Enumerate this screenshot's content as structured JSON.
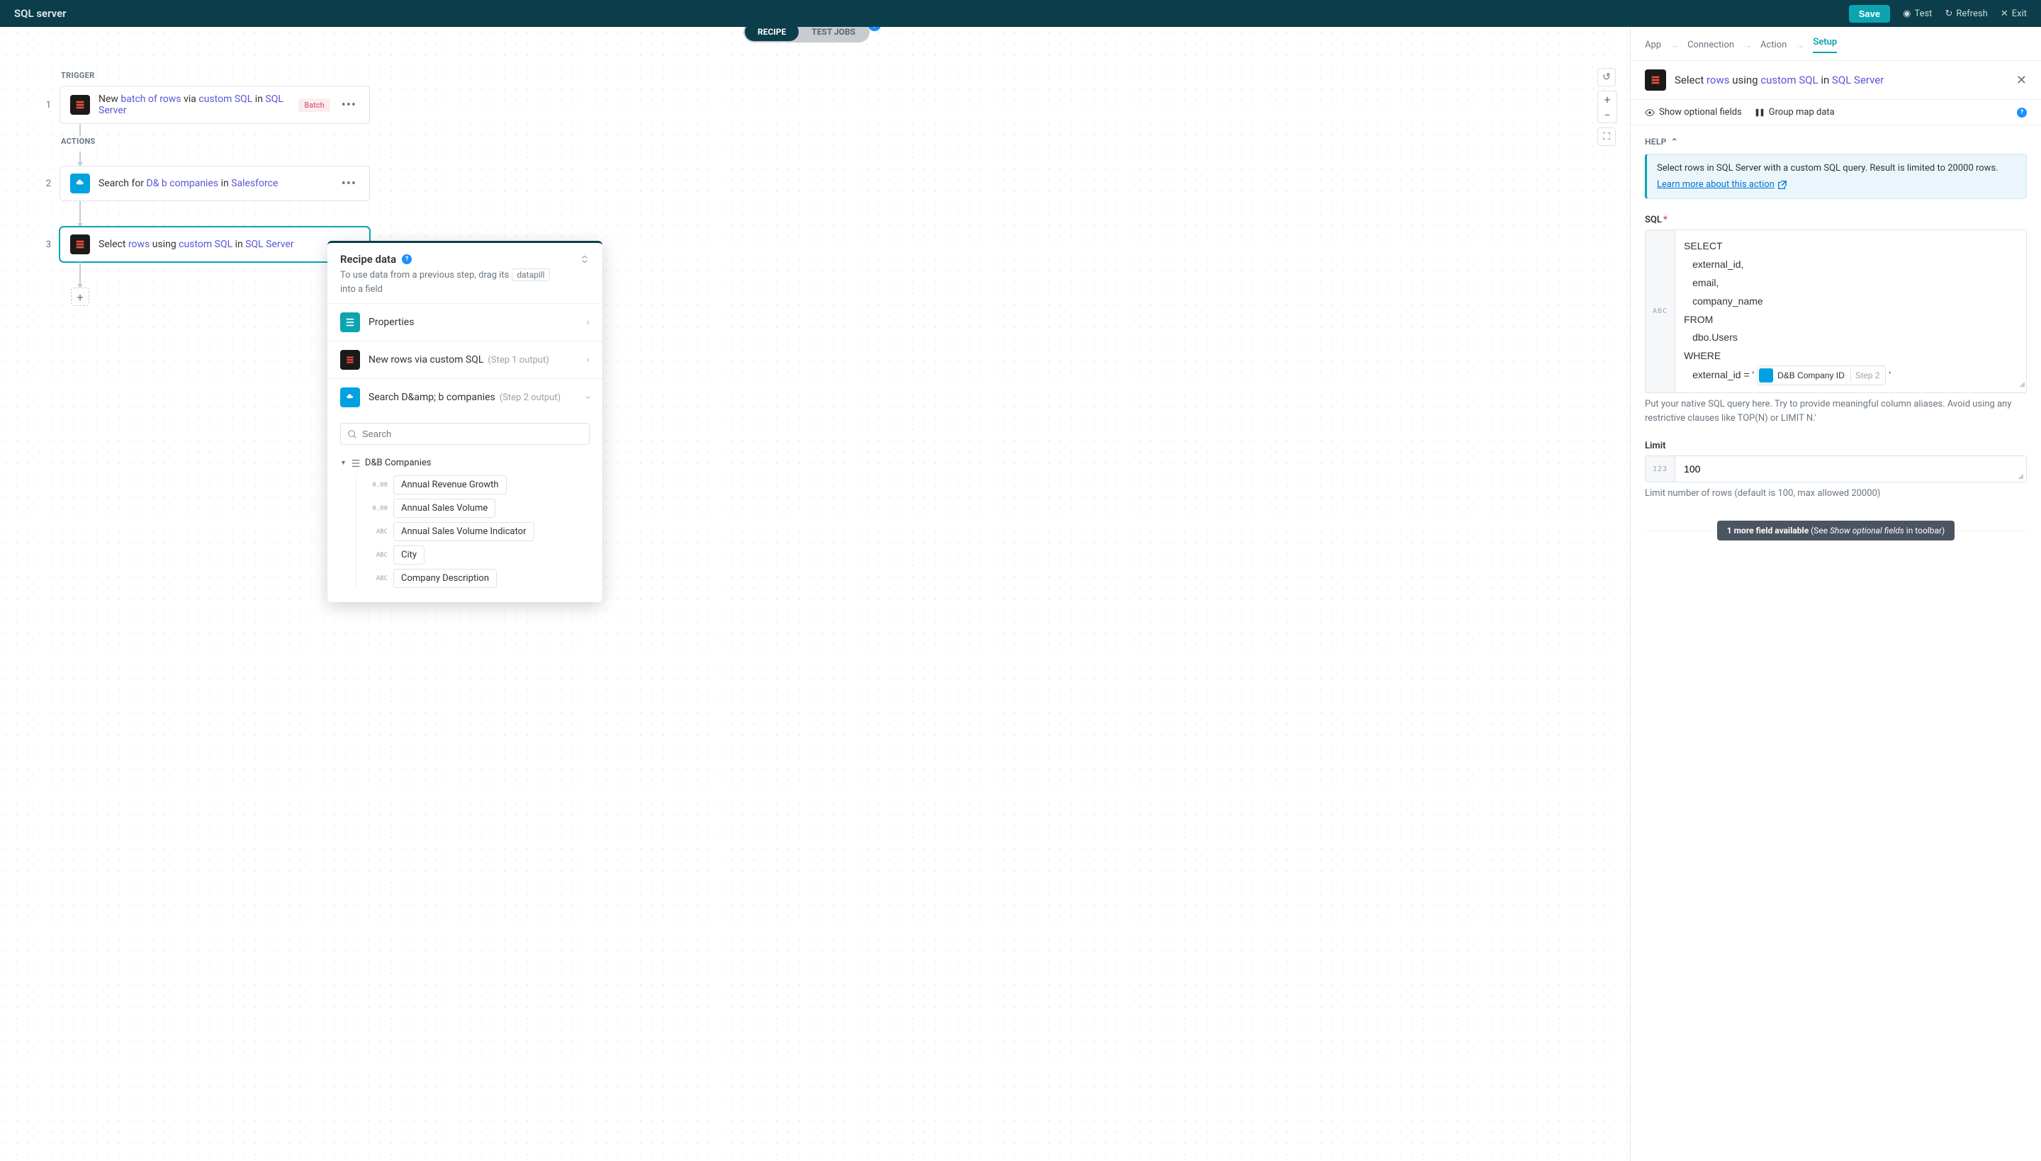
{
  "topbar": {
    "title": "SQL server",
    "save": "Save",
    "test": "Test",
    "refresh": "Refresh",
    "exit": "Exit"
  },
  "toggle": {
    "recipe": "RECIPE",
    "testjobs": "TEST JOBS"
  },
  "flow": {
    "trigger_label": "TRIGGER",
    "actions_label": "ACTIONS",
    "nodes": [
      {
        "num": "1",
        "pre": "New ",
        "hl1": "batch of rows",
        "mid1": " via ",
        "hl2": "custom SQL",
        "mid2": " in ",
        "hl3": "SQL Server",
        "batch": "Batch"
      },
      {
        "num": "2",
        "pre": "Search for ",
        "hl1": "D& b companies",
        "mid1": " in ",
        "hl2": "Salesforce"
      },
      {
        "num": "3",
        "pre": "Select ",
        "hl1": "rows",
        "mid1": " using ",
        "hl2": "custom SQL",
        "mid2": " in ",
        "hl3": "SQL Server"
      }
    ]
  },
  "recipe_panel": {
    "title": "Recipe data",
    "desc_pre": "To use data from a previous step, drag its",
    "desc_pill": "datapill",
    "desc_post": "into a field",
    "sections": {
      "properties": "Properties",
      "step1": "New rows via custom SQL",
      "step1_sub": "(Step 1 output)",
      "step2": "Search D&amp; b companies",
      "step2_sub": "(Step 2 output)"
    },
    "search_placeholder": "Search",
    "tree_group": "D&B Companies",
    "pills": [
      {
        "type": "0.00",
        "label": "Annual Revenue Growth"
      },
      {
        "type": "0.00",
        "label": "Annual Sales Volume"
      },
      {
        "type": "ABC",
        "label": "Annual Sales Volume Indicator"
      },
      {
        "type": "ABC",
        "label": "City"
      },
      {
        "type": "ABC",
        "label": "Company Description"
      }
    ]
  },
  "sidepanel": {
    "breadcrumb": [
      "App",
      "Connection",
      "Action",
      "Setup"
    ],
    "header": {
      "pre": "Select ",
      "hl1": "rows",
      "mid1": " using ",
      "hl2": "custom SQL",
      "mid2": " in ",
      "hl3": "SQL Server"
    },
    "toolbar": {
      "optional": "Show optional fields",
      "groupmap": "Group map data"
    },
    "help": {
      "label": "HELP",
      "text": "Select rows in SQL Server with a custom SQL query. Result is limited to 20000 rows.",
      "link": "Learn more about this action"
    },
    "sql": {
      "label": "SQL",
      "prefix": "ABC",
      "lines": [
        "SELECT",
        "external_id,",
        "email,",
        "company_name",
        "FROM",
        "dbo.Users",
        "WHERE"
      ],
      "where_pre": "external_id = '",
      "pill_label": "D&B Company ID",
      "pill_step": "Step 2",
      "where_post": "'",
      "help": "Put your native SQL query here. Try to provide meaningful column aliases. Avoid using any restrictive clauses like TOP(N) or LIMIT N.'"
    },
    "limit": {
      "label": "Limit",
      "prefix": "123",
      "value": "100",
      "help": "Limit number of rows (default is 100, max allowed 20000)"
    },
    "more": {
      "bold": "1 more field available",
      "mid": " (See ",
      "em": "Show optional fields",
      "post": " in toolbar)"
    }
  }
}
